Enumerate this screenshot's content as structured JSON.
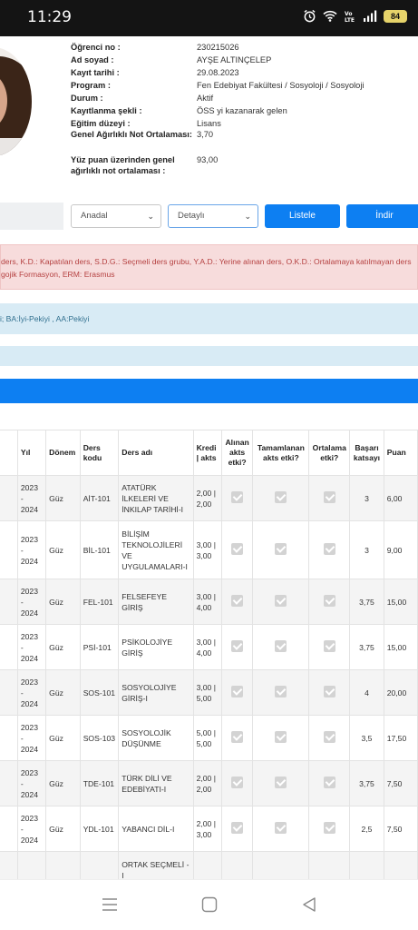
{
  "status": {
    "time": "11:29",
    "battery": "84"
  },
  "student": {
    "fields": [
      {
        "label": "Öğrenci no :",
        "value": "230215026"
      },
      {
        "label": "Ad soyad :",
        "value": "AYŞE ALTINÇELEP"
      },
      {
        "label": "Kayıt tarihi :",
        "value": "29.08.2023"
      },
      {
        "label": "Program :",
        "value": "Fen Edebiyat Fakültesi / Sosyoloji / Sosyoloji"
      },
      {
        "label": "Durum :",
        "value": "Aktif"
      },
      {
        "label": "Kayıtlanma şekli :",
        "value": "ÖSS yi kazanarak gelen"
      },
      {
        "label": "Eğitim düzeyi :",
        "value": "Lisans"
      },
      {
        "label": "Genel Ağırlıklı Not Ortalaması:",
        "value": "3,70"
      },
      {
        "label": "Yüz puan üzerinden genel ağırlıklı not ortalaması :",
        "value": "93,00"
      }
    ]
  },
  "filters": {
    "select1": "Anadal",
    "select2": "Detaylı",
    "list_button": "Listele",
    "download_button": "İndir"
  },
  "alerts": {
    "legend_line1": "ders, K.D.: Kapatılan ders, S.D.G.: Seçmeli ders grubu, Y.A.D.: Yerine alınan ders, O.K.D.: Ortalamaya katılmayan ders",
    "legend_line2": "gojik Formasyon, ERM: Erasmus",
    "grades": "i; BA:İyi-Pekiyi , AA:Pekiyi"
  },
  "table": {
    "headers": [
      "Yıl",
      "Dönem",
      "Ders kodu",
      "Ders adı",
      "Kredi | akts",
      "Alınan akts etki?",
      "Tamamlanan akts etki?",
      "Ortalama etki?",
      "Başarı katsayı",
      "Puan"
    ],
    "rows": [
      {
        "yil": "2023 - 2024",
        "donem": "Güz",
        "kod": "AİT-101",
        "ad": "ATATÜRK İLKELERİ VE İNKILAP TARİHİ-I",
        "kredi": "2,00 | 2,00",
        "katsayi": "3",
        "puan": "6,00"
      },
      {
        "yil": "2023 - 2024",
        "donem": "Güz",
        "kod": "BİL-101",
        "ad": "BİLİŞİM TEKNOLOJİLERİ VE UYGULAMALARI-I",
        "kredi": "3,00 | 3,00",
        "katsayi": "3",
        "puan": "9,00"
      },
      {
        "yil": "2023 - 2024",
        "donem": "Güz",
        "kod": "FEL-101",
        "ad": "FELSEFEYE GİRİŞ",
        "kredi": "3,00 | 4,00",
        "katsayi": "3,75",
        "puan": "15,00"
      },
      {
        "yil": "2023 - 2024",
        "donem": "Güz",
        "kod": "PSİ-101",
        "ad": "PSİKOLOJİYE GİRİŞ",
        "kredi": "3,00 | 4,00",
        "katsayi": "3,75",
        "puan": "15,00"
      },
      {
        "yil": "2023 - 2024",
        "donem": "Güz",
        "kod": "SOS-101",
        "ad": "SOSYOLOJİYE GİRİŞ-I",
        "kredi": "3,00 | 5,00",
        "katsayi": "4",
        "puan": "20,00"
      },
      {
        "yil": "2023 - 2024",
        "donem": "Güz",
        "kod": "SOS-103",
        "ad": "SOSYOLOJİK DÜŞÜNME",
        "kredi": "5,00 | 5,00",
        "katsayi": "3,5",
        "puan": "17,50"
      },
      {
        "yil": "2023 - 2024",
        "donem": "Güz",
        "kod": "TDE-101",
        "ad": "TÜRK DİLİ VE EDEBİYATI-I",
        "kredi": "2,00 | 2,00",
        "katsayi": "3,75",
        "puan": "7,50"
      },
      {
        "yil": "2023 - 2024",
        "donem": "Güz",
        "kod": "YDL-101",
        "ad": "YABANCI DİL-I",
        "kredi": "2,00 | 3,00",
        "katsayi": "2,5",
        "puan": "7,50"
      },
      {
        "yil": "",
        "donem": "",
        "kod": "",
        "ad": "ORTAK SEÇMELİ - I",
        "kredi": "",
        "katsayi": "",
        "puan": ""
      }
    ]
  },
  "colors": {
    "accent": "#0d7ff2",
    "alert_red": "#f7dcdc",
    "alert_blue": "#d8ebf5"
  },
  "icons": [
    "alarm-icon",
    "wifi-icon",
    "volte-icon",
    "signal-icon",
    "battery-icon",
    "menu-nav-icon",
    "home-nav-icon",
    "back-nav-icon"
  ]
}
